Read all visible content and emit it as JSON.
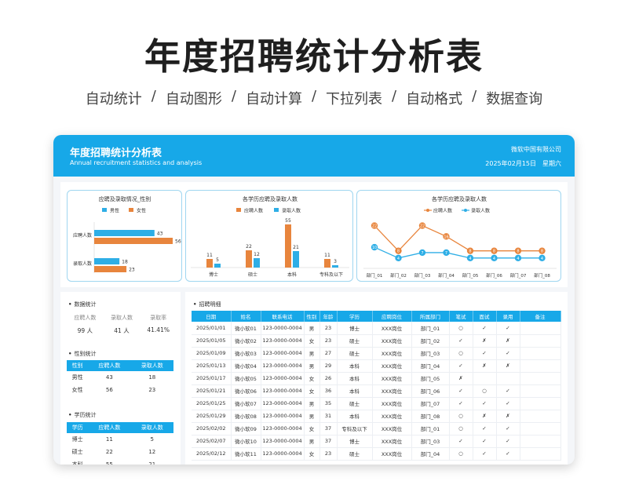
{
  "promo": {
    "title": "年度招聘统计分析表",
    "features": [
      "自动统计",
      "自动图形",
      "自动计算",
      "下拉列表",
      "自动格式",
      "数据查询"
    ]
  },
  "card": {
    "title": "年度招聘统计分析表",
    "subtitle": "Annual recruitment statistics and analysis",
    "company": "微软中国有限公司",
    "date": "2025年02月15日",
    "weekday": "星期六"
  },
  "colors": {
    "primary": "#17a8e8",
    "orange": "#e8853d",
    "blue": "#2eaee6"
  },
  "chart_data": [
    {
      "type": "bar",
      "orientation": "horizontal",
      "title": "应聘及录取情况_性别",
      "categories": [
        "应聘人数",
        "录取人数"
      ],
      "series": [
        {
          "name": "男性",
          "values": [
            43,
            18
          ]
        },
        {
          "name": "女性",
          "values": [
            56,
            23
          ]
        }
      ],
      "legend": "top"
    },
    {
      "type": "bar",
      "title": "各学历应聘及录取人数",
      "categories": [
        "博士",
        "硕士",
        "本科",
        "专科及以下"
      ],
      "series": [
        {
          "name": "应聘人数",
          "values": [
            11,
            22,
            55,
            11
          ]
        },
        {
          "name": "录取人数",
          "values": [
            5,
            12,
            21,
            3
          ]
        }
      ],
      "legend": "top"
    },
    {
      "type": "line",
      "title": "各学历应聘及录取人数",
      "categories": [
        "部门_01",
        "部门_02",
        "部门_03",
        "部门_04",
        "部门_05",
        "部门_06",
        "部门_07",
        "部门_08"
      ],
      "series": [
        {
          "name": "应聘人数",
          "values": [
            22,
            8,
            22,
            16,
            8,
            8,
            8,
            8
          ]
        },
        {
          "name": "录取人数",
          "values": [
            10,
            4,
            7,
            7,
            4,
            4,
            4,
            4
          ]
        }
      ],
      "legend": "top"
    }
  ],
  "data_stats": {
    "title": "数据统计",
    "labels": [
      "应聘人数",
      "录取人数",
      "录取率"
    ],
    "values": [
      "99 人",
      "41 人",
      "41.41%"
    ]
  },
  "gender_stats": {
    "title": "性别统计",
    "headers": [
      "性别",
      "应聘人数",
      "录取人数"
    ],
    "rows": [
      [
        "男性",
        "43",
        "18"
      ],
      [
        "女性",
        "56",
        "23"
      ]
    ]
  },
  "edu_stats": {
    "title": "学历统计",
    "headers": [
      "学历",
      "应聘人数",
      "录取人数"
    ],
    "rows": [
      [
        "博士",
        "11",
        "5"
      ],
      [
        "硕士",
        "22",
        "12"
      ],
      [
        "本科",
        "55",
        "21"
      ]
    ]
  },
  "detail": {
    "title": "招聘明细",
    "headers": [
      "日期",
      "姓名",
      "联系电话",
      "性别",
      "年龄",
      "学历",
      "应聘岗位",
      "所属部门",
      "笔试",
      "面试",
      "录用",
      "备注"
    ],
    "rows": [
      [
        "2025/01/01",
        "微小软01",
        "123-0000-0004",
        "男",
        "23",
        "博士",
        "XXX岗位",
        "部门_01",
        "○",
        "✓",
        "✓",
        ""
      ],
      [
        "2025/01/05",
        "微小软02",
        "123-0000-0004",
        "女",
        "23",
        "硕士",
        "XXX岗位",
        "部门_02",
        "✓",
        "✗",
        "✗",
        ""
      ],
      [
        "2025/01/09",
        "微小软03",
        "123-0000-0004",
        "男",
        "27",
        "硕士",
        "XXX岗位",
        "部门_03",
        "○",
        "✓",
        "✓",
        ""
      ],
      [
        "2025/01/13",
        "微小软04",
        "123-0000-0004",
        "男",
        "29",
        "本科",
        "XXX岗位",
        "部门_04",
        "✓",
        "✗",
        "✗",
        ""
      ],
      [
        "2025/01/17",
        "微小软05",
        "123-0000-0004",
        "女",
        "26",
        "本科",
        "XXX岗位",
        "部门_05",
        "✗",
        "",
        "",
        ""
      ],
      [
        "2025/01/21",
        "微小软06",
        "123-0000-0004",
        "女",
        "36",
        "本科",
        "XXX岗位",
        "部门_06",
        "✓",
        "○",
        "✓",
        ""
      ],
      [
        "2025/01/25",
        "微小软07",
        "123-0000-0004",
        "男",
        "35",
        "硕士",
        "XXX岗位",
        "部门_07",
        "✓",
        "✓",
        "✓",
        ""
      ],
      [
        "2025/01/29",
        "微小软08",
        "123-0000-0004",
        "男",
        "31",
        "本科",
        "XXX岗位",
        "部门_08",
        "○",
        "✗",
        "✗",
        ""
      ],
      [
        "2025/02/02",
        "微小软09",
        "123-0000-0004",
        "女",
        "37",
        "专科及以下",
        "XXX岗位",
        "部门_01",
        "○",
        "✓",
        "✓",
        ""
      ],
      [
        "2025/02/07",
        "微小软10",
        "123-0000-0004",
        "男",
        "37",
        "博士",
        "XXX岗位",
        "部门_03",
        "✓",
        "✓",
        "✓",
        ""
      ],
      [
        "2025/02/12",
        "微小软11",
        "123-0000-0004",
        "女",
        "23",
        "硕士",
        "XXX岗位",
        "部门_04",
        "○",
        "✓",
        "✓",
        ""
      ]
    ]
  }
}
